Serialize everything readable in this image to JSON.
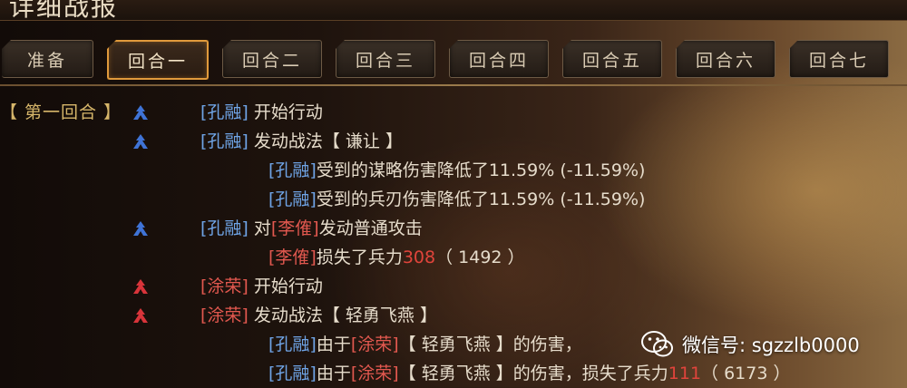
{
  "window": {
    "title": "详细战报"
  },
  "tabs": [
    {
      "label": "准备",
      "active": false
    },
    {
      "label": "回合一",
      "active": true
    },
    {
      "label": "回合二",
      "active": false
    },
    {
      "label": "回合三",
      "active": false
    },
    {
      "label": "回合四",
      "active": false
    },
    {
      "label": "回合五",
      "active": false
    },
    {
      "label": "回合六",
      "active": false
    },
    {
      "label": "回合七",
      "active": false
    }
  ],
  "log": {
    "round_label": "【 第一回合 】",
    "entries": [
      {
        "side": "blue",
        "icon": "blue-army-icon",
        "actor": "[孔融]",
        "text": "开始行动"
      },
      {
        "side": "blue",
        "icon": "blue-army-icon",
        "actor": "[孔融]",
        "text": "发动战法【 谦让 】"
      },
      {
        "actor": "[孔融]",
        "text": "受到的谋略伤害降低了11.59% (-11.59%)"
      },
      {
        "actor": "[孔融]",
        "text": "受到的兵刃伤害降低了11.59% (-11.59%)"
      },
      {
        "side": "blue",
        "icon": "blue-army-icon",
        "actor": "[孔融]",
        "text_a": "对",
        "target": "[李傕]",
        "text_b": "发动普通攻击"
      },
      {
        "actor": "[李傕]",
        "text_a": "损失了兵力",
        "loss": "308",
        "text_b": "（ 1492 ）"
      },
      {
        "side": "red",
        "icon": "red-army-icon",
        "actor": "[涂荣]",
        "text": "开始行动"
      },
      {
        "side": "red",
        "icon": "red-army-icon",
        "actor": "[涂荣]",
        "text": "发动战法【 轻勇飞燕 】"
      },
      {
        "actor": "[孔融]",
        "text_a": "由于",
        "source": "[涂荣]",
        "text_b": "【 轻勇飞燕 】的伤害，"
      },
      {
        "actor": "[孔融]",
        "text_a": "由于",
        "source": "[涂荣]",
        "text_b": "【 轻勇飞燕 】的伤害，损失了兵力",
        "loss": "111",
        "text_c": "（ 6173 ）"
      }
    ]
  },
  "watermark": {
    "icon": "wechat-icon",
    "text": "微信号: sgzzlb0000"
  },
  "colors": {
    "blue": "#6fa4e6",
    "red": "#e2584f",
    "accent": "#e09a3c",
    "gold": "#d6b66a"
  }
}
